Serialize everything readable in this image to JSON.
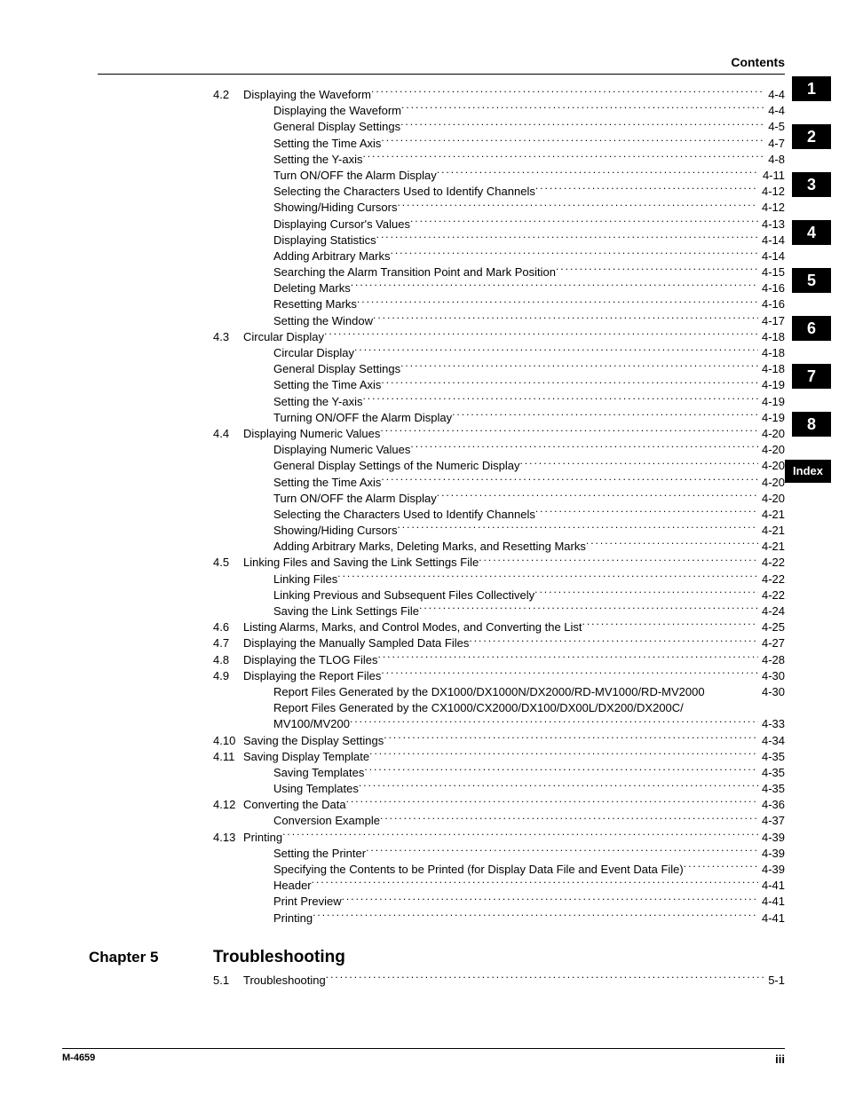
{
  "header": {
    "title": "Contents"
  },
  "tabs": [
    "1",
    "2",
    "3",
    "4",
    "5",
    "6",
    "7",
    "8",
    "Index"
  ],
  "chapter": {
    "label": "Chapter 5",
    "title": "Troubleshooting"
  },
  "footer": {
    "left": "M-4659",
    "right": "iii"
  },
  "toc": [
    {
      "num": "4.2",
      "indent": 0,
      "title": "Displaying the Waveform",
      "page": "4-4"
    },
    {
      "num": "",
      "indent": 1,
      "title": "Displaying the Waveform",
      "page": "4-4"
    },
    {
      "num": "",
      "indent": 1,
      "title": "General Display Settings",
      "page": "4-5"
    },
    {
      "num": "",
      "indent": 1,
      "title": "Setting the Time Axis",
      "page": "4-7"
    },
    {
      "num": "",
      "indent": 1,
      "title": "Setting the Y-axis",
      "page": "4-8"
    },
    {
      "num": "",
      "indent": 1,
      "title": "Turn ON/OFF the Alarm Display",
      "page": "4-11"
    },
    {
      "num": "",
      "indent": 1,
      "title": "Selecting the Characters Used to Identify Channels",
      "page": "4-12"
    },
    {
      "num": "",
      "indent": 1,
      "title": "Showing/Hiding Cursors",
      "page": "4-12"
    },
    {
      "num": "",
      "indent": 1,
      "title": "Displaying Cursor's Values",
      "page": "4-13"
    },
    {
      "num": "",
      "indent": 1,
      "title": "Displaying Statistics",
      "page": "4-14"
    },
    {
      "num": "",
      "indent": 1,
      "title": "Adding Arbitrary Marks",
      "page": "4-14"
    },
    {
      "num": "",
      "indent": 1,
      "title": "Searching the Alarm Transition Point and Mark Position",
      "page": "4-15"
    },
    {
      "num": "",
      "indent": 1,
      "title": "Deleting Marks",
      "page": "4-16"
    },
    {
      "num": "",
      "indent": 1,
      "title": "Resetting Marks",
      "page": "4-16"
    },
    {
      "num": "",
      "indent": 1,
      "title": "Setting the Window",
      "page": "4-17"
    },
    {
      "num": "4.3",
      "indent": 0,
      "title": "Circular Display",
      "page": "4-18"
    },
    {
      "num": "",
      "indent": 1,
      "title": "Circular Display",
      "page": "4-18"
    },
    {
      "num": "",
      "indent": 1,
      "title": "General Display Settings",
      "page": "4-18"
    },
    {
      "num": "",
      "indent": 1,
      "title": "Setting the Time Axis",
      "page": "4-19"
    },
    {
      "num": "",
      "indent": 1,
      "title": "Setting the Y-axis",
      "page": "4-19"
    },
    {
      "num": "",
      "indent": 1,
      "title": "Turning ON/OFF the Alarm Display",
      "page": "4-19"
    },
    {
      "num": "4.4",
      "indent": 0,
      "title": "Displaying Numeric Values",
      "page": "4-20"
    },
    {
      "num": "",
      "indent": 1,
      "title": "Displaying Numeric Values",
      "page": "4-20"
    },
    {
      "num": "",
      "indent": 1,
      "title": "General Display Settings of the Numeric Display",
      "page": "4-20"
    },
    {
      "num": "",
      "indent": 1,
      "title": "Setting the Time Axis",
      "page": "4-20"
    },
    {
      "num": "",
      "indent": 1,
      "title": "Turn ON/OFF the Alarm Display",
      "page": "4-20"
    },
    {
      "num": "",
      "indent": 1,
      "title": "Selecting the Characters Used to Identify Channels",
      "page": "4-21"
    },
    {
      "num": "",
      "indent": 1,
      "title": "Showing/Hiding Cursors",
      "page": "4-21"
    },
    {
      "num": "",
      "indent": 1,
      "title": "Adding Arbitrary Marks, Deleting Marks, and Resetting Marks",
      "page": "4-21"
    },
    {
      "num": "4.5",
      "indent": 0,
      "title": "Linking Files and Saving the Link Settings File",
      "page": "4-22"
    },
    {
      "num": "",
      "indent": 1,
      "title": "Linking Files",
      "page": "4-22"
    },
    {
      "num": "",
      "indent": 1,
      "title": "Linking Previous and Subsequent Files Collectively",
      "page": "4-22"
    },
    {
      "num": "",
      "indent": 1,
      "title": "Saving the Link Settings File",
      "page": "4-24"
    },
    {
      "num": "4.6",
      "indent": 0,
      "title": "Listing Alarms, Marks, and Control Modes, and Converting the List",
      "page": "4-25"
    },
    {
      "num": "4.7",
      "indent": 0,
      "title": "Displaying the Manually Sampled Data Files",
      "page": "4-27"
    },
    {
      "num": "4.8",
      "indent": 0,
      "title": "Displaying the TLOG Files",
      "page": "4-28"
    },
    {
      "num": "4.9",
      "indent": 0,
      "title": "Displaying the Report Files",
      "page": "4-30"
    },
    {
      "num": "",
      "indent": 1,
      "title": "Report Files Generated by the DX1000/DX1000N/DX2000/RD-MV1000/RD-MV2000",
      "page": "4-30",
      "noleader": true
    },
    {
      "num": "",
      "indent": 1,
      "title": "Report Files Generated by the CX1000/CX2000/DX100/DX00L/DX200/DX200C/",
      "page": "",
      "noleader": true,
      "nopg": true
    },
    {
      "num": "",
      "indent": 1,
      "title": "MV100/MV200",
      "page": "4-33"
    },
    {
      "num": "4.10",
      "indent": 0,
      "title": "Saving the Display Settings",
      "page": "4-34"
    },
    {
      "num": "4.11",
      "indent": 0,
      "title": "Saving Display Template",
      "page": "4-35"
    },
    {
      "num": "",
      "indent": 1,
      "title": "Saving Templates",
      "page": "4-35"
    },
    {
      "num": "",
      "indent": 1,
      "title": "Using Templates",
      "page": "4-35"
    },
    {
      "num": "4.12",
      "indent": 0,
      "title": "Converting the Data",
      "page": "4-36"
    },
    {
      "num": "",
      "indent": 1,
      "title": "Conversion Example",
      "page": "4-37"
    },
    {
      "num": "4.13",
      "indent": 0,
      "title": "Printing",
      "page": "4-39"
    },
    {
      "num": "",
      "indent": 1,
      "title": "Setting the Printer",
      "page": "4-39"
    },
    {
      "num": "",
      "indent": 1,
      "title": "Specifying the Contents to be Printed (for Display Data File and Event Data File)",
      "page": "4-39"
    },
    {
      "num": "",
      "indent": 1,
      "title": "Header",
      "page": "4-41"
    },
    {
      "num": "",
      "indent": 1,
      "title": "Print Preview",
      "page": "4-41"
    },
    {
      "num": "",
      "indent": 1,
      "title": "Printing",
      "page": "4-41"
    }
  ],
  "toc2": [
    {
      "num": "5.1",
      "indent": 0,
      "title": "Troubleshooting",
      "page": "5-1"
    }
  ]
}
